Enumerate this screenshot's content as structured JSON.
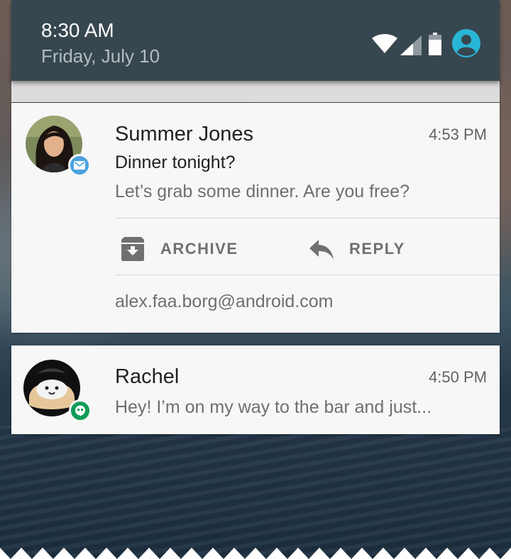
{
  "status_bar": {
    "time": "8:30 AM",
    "date": "Friday, July 10",
    "icons": [
      "wifi-icon",
      "signal-icon",
      "battery-icon",
      "account-icon"
    ],
    "accent_color": "#29b6d6"
  },
  "notifications": [
    {
      "sender": "Summer Jones",
      "time": "4:53 PM",
      "subject": "Dinner tonight?",
      "preview": "Let’s grab some dinner. Are you free?",
      "app_badge": "email-icon",
      "badge_color": "#4aa3df",
      "actions": [
        {
          "label": "ARCHIVE",
          "icon": "archive-icon"
        },
        {
          "label": "REPLY",
          "icon": "reply-icon"
        }
      ],
      "account": "alex.faa.borg@android.com"
    },
    {
      "sender": "Rachel",
      "time": "4:50 PM",
      "preview": "Hey! I’m on my way to the bar and just...",
      "app_badge": "hangouts-icon",
      "badge_color": "#0f9d58"
    }
  ]
}
